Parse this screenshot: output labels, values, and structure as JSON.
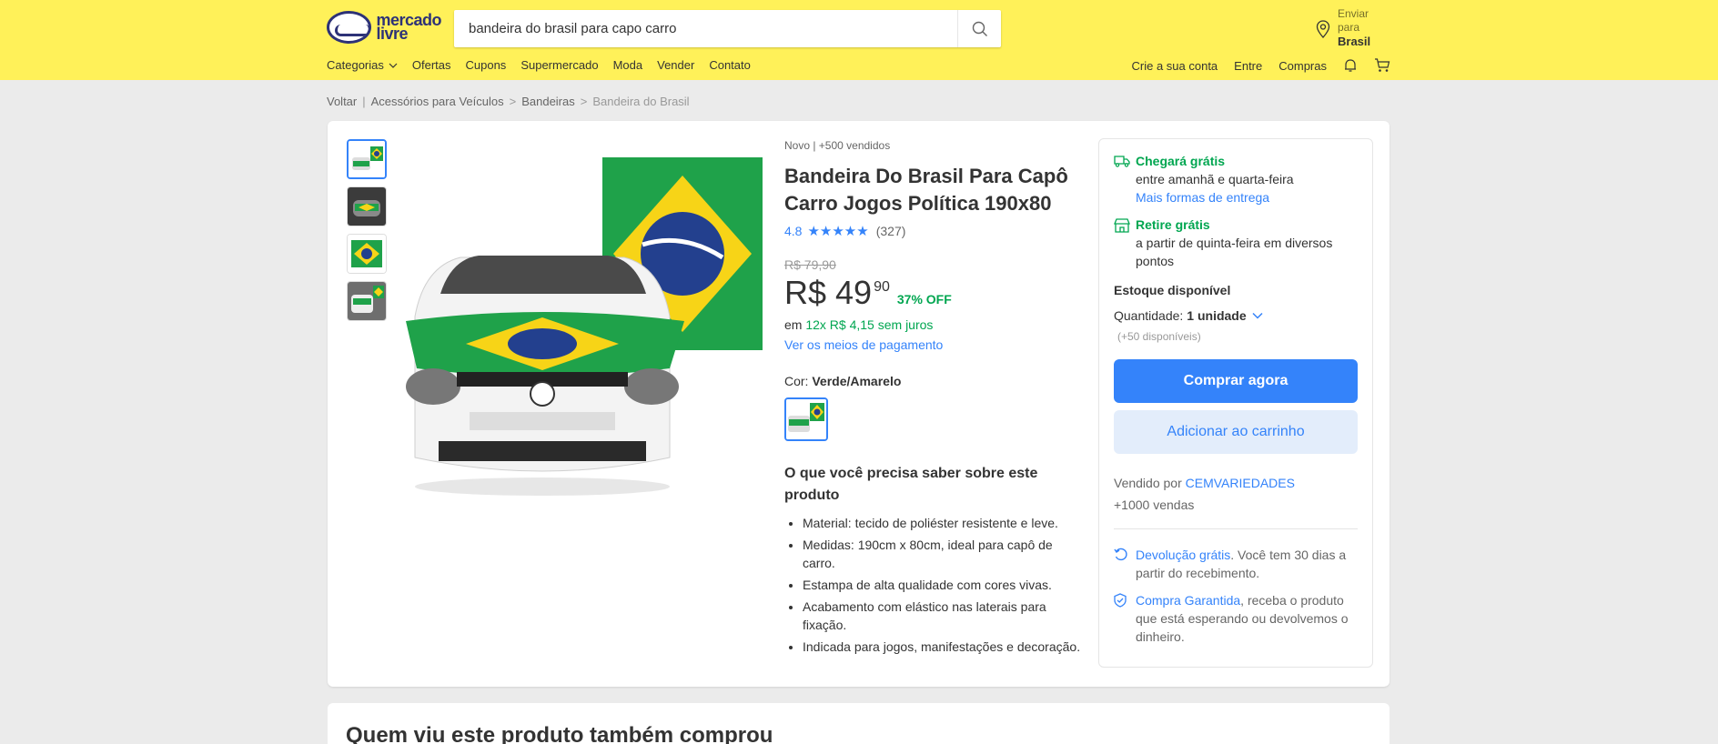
{
  "header": {
    "logo_line1": "mercado",
    "logo_line2": "livre",
    "search_value": "bandeira do brasil para capo carro",
    "enviar_line1": "Enviar",
    "enviar_line2": "para",
    "enviar_location": "Brasil",
    "nav_left": [
      "Categorias",
      "Ofertas",
      "Cupons",
      "Supermercado",
      "Moda",
      "Vender",
      "Contato"
    ],
    "nav_right": [
      "Crie a sua conta",
      "Entre",
      "Compras"
    ]
  },
  "breadcrumb": {
    "back": "Voltar",
    "items": [
      "Acessórios para Veículos",
      "Bandeiras",
      "Bandeira do Brasil"
    ]
  },
  "product": {
    "condition": "Novo  |  +500 vendidos",
    "title": "Bandeira Do Brasil Para Capô Carro Jogos Política 190x80",
    "rating": "4.8",
    "stars": "★★★★★",
    "reviews": "(327)",
    "old_price": "R$ 79,90",
    "price": "R$ 49",
    "cents": "90",
    "discount": "37% OFF",
    "install_prefix": "em ",
    "install_green": "12x R$ 4,15 sem juros",
    "payment_link": "Ver os meios de pagamento",
    "color_label": "Cor: ",
    "color_value": "Verde/Amarelo",
    "know_title": "O que você precisa saber sobre este produto",
    "features": [
      "Material: tecido de poliéster resistente e leve.",
      "Medidas: 190cm x 80cm, ideal para capô de carro.",
      "Estampa de alta qualidade com cores vivas.",
      "Acabamento com elástico nas laterais para fixação.",
      "Indicada para jogos, manifestações e decoração."
    ]
  },
  "buybox": {
    "ship_title": "Chegará grátis",
    "ship_sub": "entre amanhã e quarta-feira",
    "ship_link": "Mais formas de entrega",
    "pickup_title": "Retire grátis",
    "pickup_sub": "a partir de quinta-feira em diversos pontos",
    "stock": "Estoque disponível",
    "qty_label": "Quantidade:",
    "qty_value": "1 unidade",
    "available": "(+50 disponíveis)",
    "buy_now": "Comprar agora",
    "add_cart": "Adicionar ao carrinho",
    "sold_by": "Vendido por ",
    "seller": "CEMVARIEDADES",
    "sales": "+1000 vendas",
    "return_link": "Devolução grátis",
    "return_text": ". Você tem 30 dias a partir do recebimento.",
    "guarantee_link": "Compra Garantida",
    "guarantee_text": ", receba o produto que está esperando ou devolvemos o dinheiro."
  },
  "section2": {
    "title": "Quem viu este produto também comprou"
  },
  "colors": {
    "header_bg": "#fff159",
    "accent_blue": "#3483fa",
    "green": "#00a650"
  }
}
